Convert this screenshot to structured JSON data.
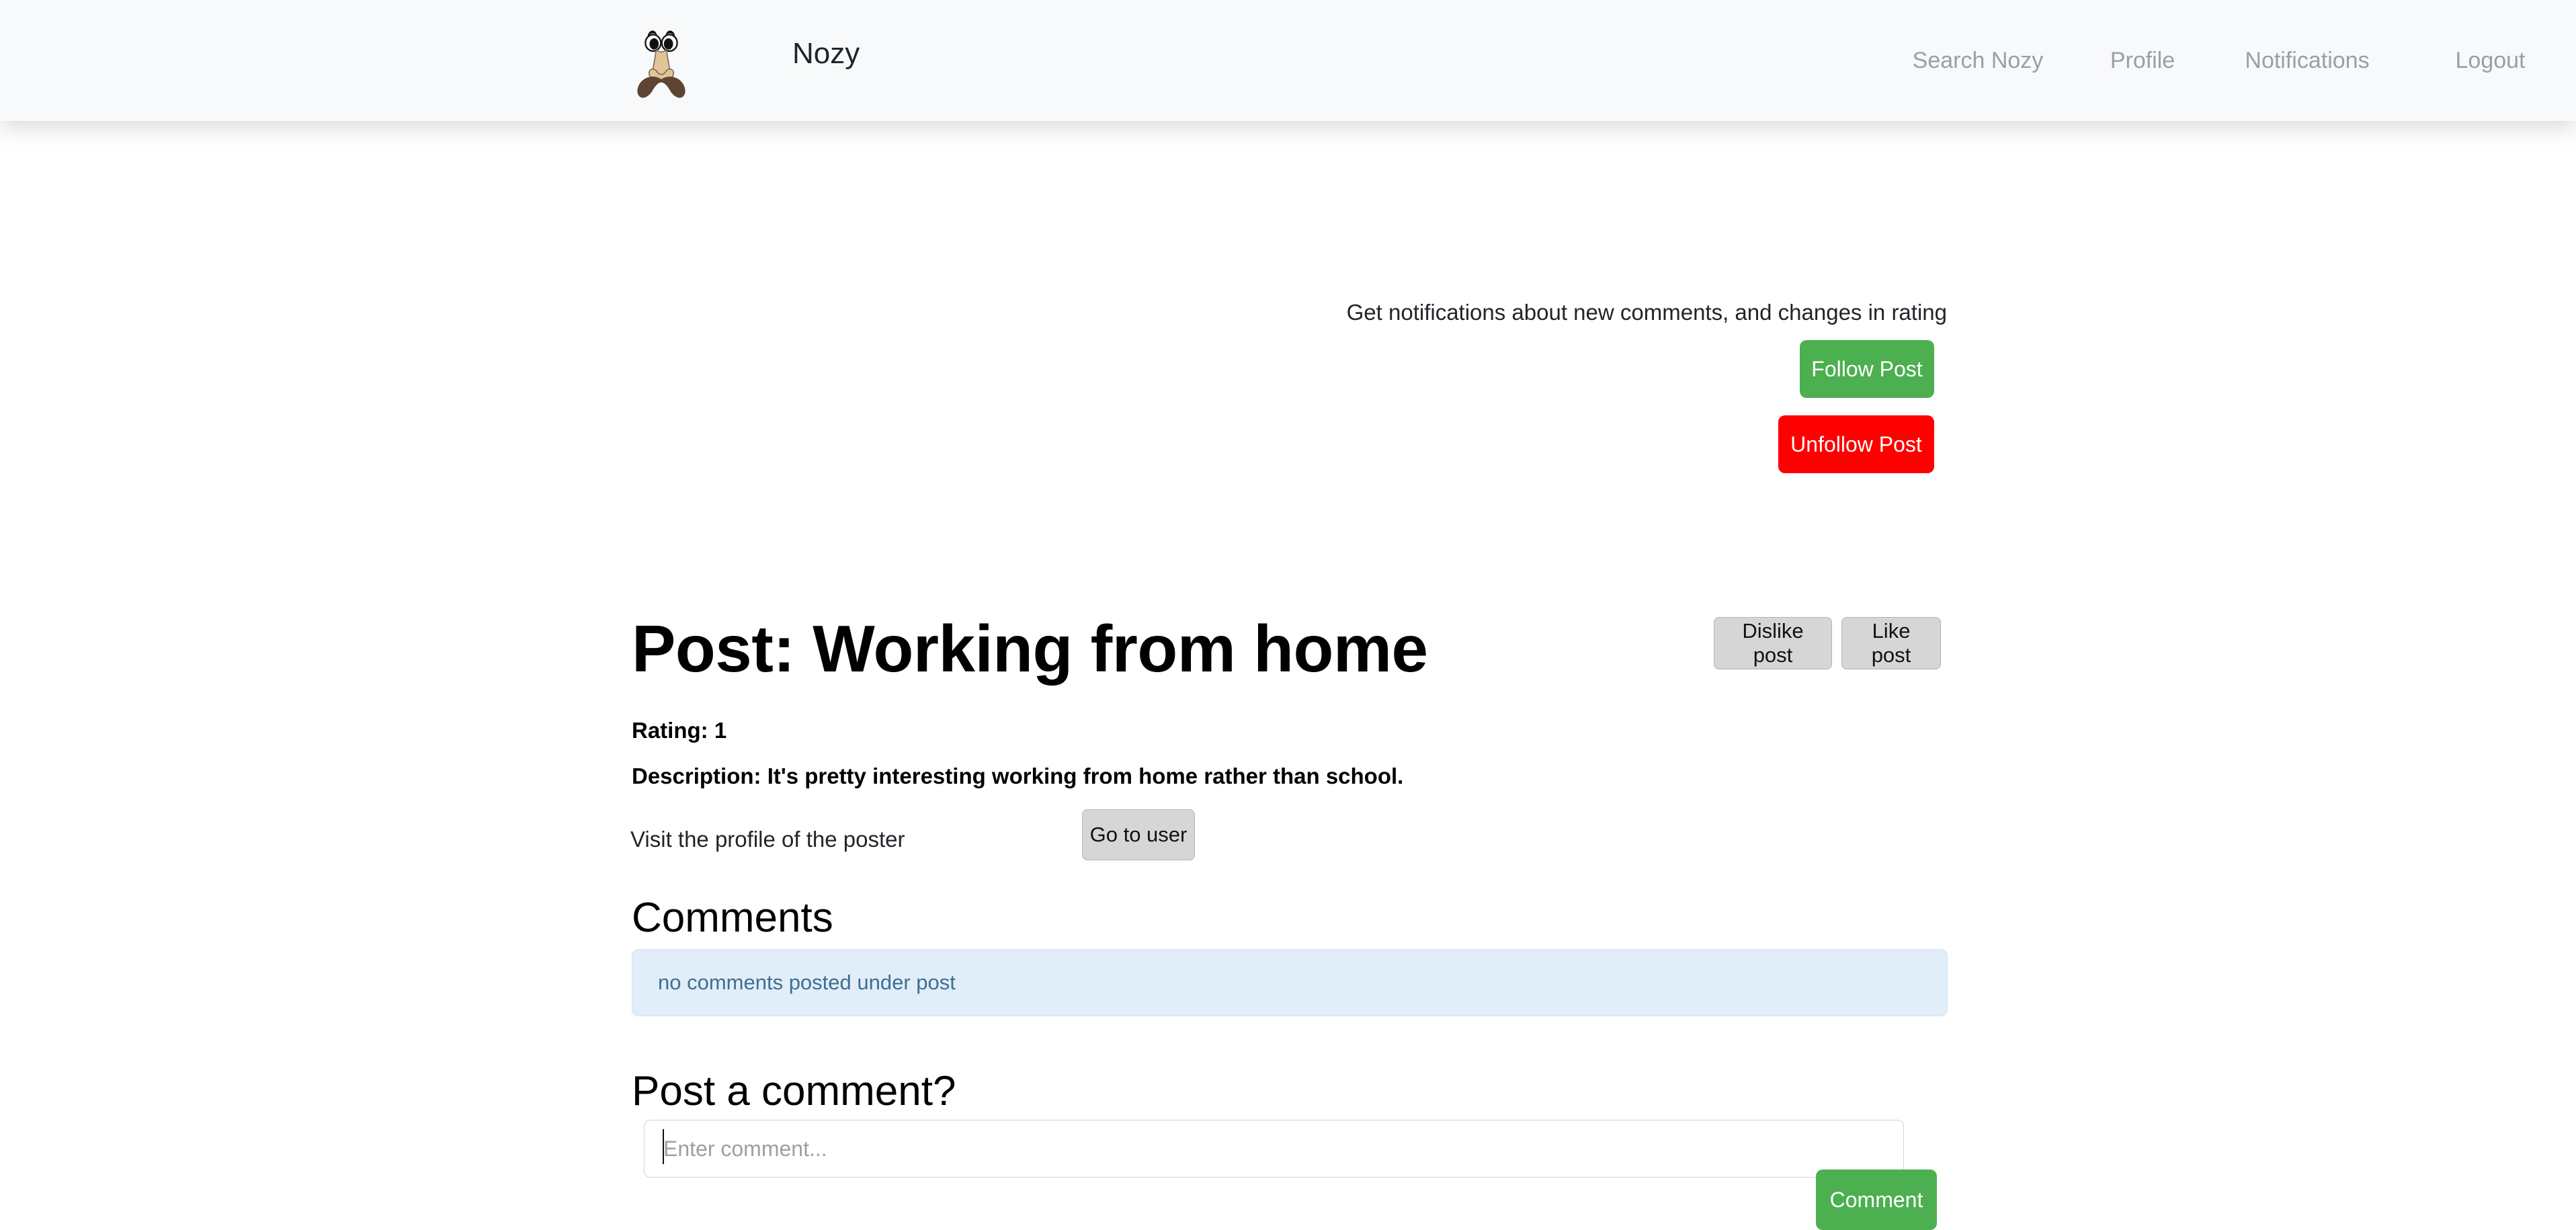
{
  "header": {
    "logo_icon": "groucho-disguise-icon",
    "brand": "Nozy",
    "nav": [
      {
        "label": "Search Nozy",
        "name": "nav-link-search-nozy"
      },
      {
        "label": "Profile",
        "name": "nav-link-profile"
      },
      {
        "label": "Notifications",
        "name": "nav-link-notifications"
      },
      {
        "label": "Logout",
        "name": "nav-link-logout"
      }
    ]
  },
  "follow": {
    "notify_text": "Get notifications about new comments, and changes in rating",
    "follow_label": "Follow Post",
    "unfollow_label": "Unfollow Post",
    "follow_color": "#4caf50",
    "unfollow_color": "#ff0000"
  },
  "vote": {
    "dislike_label": "Dislike post",
    "like_label": "Like post"
  },
  "post": {
    "title": "Post: Working from home",
    "rating": "Rating: 1",
    "description": "Description: It's pretty interesting working from home rather than school.",
    "visit_text": "Visit the profile of the poster",
    "go_to_user_label": "Go to user"
  },
  "comments": {
    "heading": "Comments",
    "empty_message": "no comments posted under post",
    "empty_bg": "#e1edf8",
    "empty_fg": "#3d6f91"
  },
  "comment_form": {
    "heading": "Post a comment?",
    "input_value": "",
    "input_placeholder": "Enter comment...",
    "submit_label": "Comment"
  }
}
